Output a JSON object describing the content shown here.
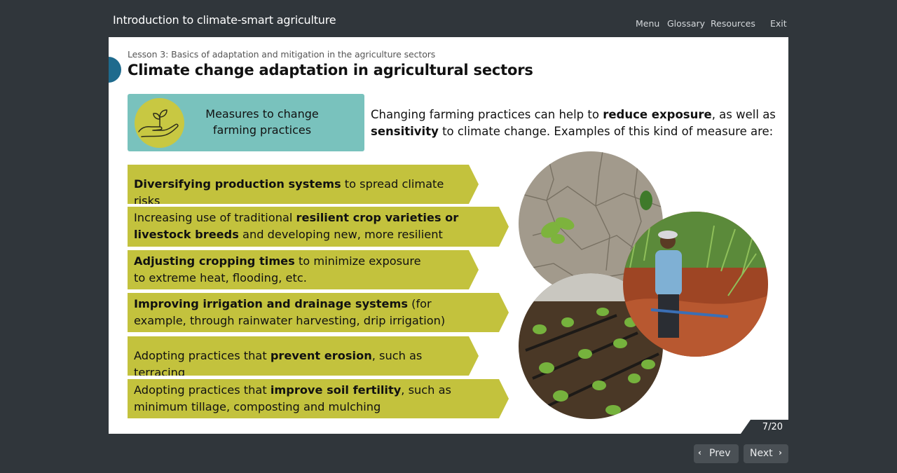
{
  "header": {
    "course_title": "Introduction to climate-smart agriculture",
    "nav": {
      "menu": "Menu",
      "glossary": "Glossary",
      "resources": "Resources",
      "exit": "Exit"
    }
  },
  "slide": {
    "lesson_subtitle": "Lesson 3: Basics of adaptation and mitigation in the agriculture sectors",
    "title": "Climate change adaptation in agricultural sectors",
    "measure_box": {
      "line1": "Measures to change",
      "line2": "farming practices",
      "icon": "hand-sprout-icon"
    },
    "intro": {
      "t1": "Changing farming practices can help to ",
      "b1": "reduce exposure",
      "t2": ", as well as ",
      "b2": "sensitivity",
      "t3": " to climate change. Examples of this kind of measure are:"
    },
    "measures": [
      {
        "bold": "Diversifying production systems",
        "rest": " to spread climate risks"
      },
      {
        "pre": "Increasing use of traditional ",
        "bold": "resilient crop varieties or livestock breeds",
        "rest": " and developing new, more resilient varieties"
      },
      {
        "bold": "Adjusting cropping times",
        "rest": " to minimize exposure to extreme heat, flooding, etc."
      },
      {
        "bold": "Improving irrigation and drainage systems",
        "rest": " (for example, through rainwater harvesting, drip irrigation)"
      },
      {
        "pre": "Adopting practices that ",
        "bold": "prevent erosion",
        "rest": ", such as terracing"
      },
      {
        "pre": "Adopting practices that ",
        "bold": "improve soil fertility",
        "rest": ", such as minimum tillage, composting and mulching"
      }
    ],
    "colors": {
      "teal_box": "#79c2bd",
      "olive_arrow": "#c3c23d",
      "icon_circle": "#c8c842",
      "lesson_dot": "#1e6a8d"
    }
  },
  "footer": {
    "page_indicator": "7/20",
    "prev_label": "Prev",
    "next_label": "Next",
    "prev_icon": "chevron-left-icon",
    "next_icon": "chevron-right-icon"
  }
}
